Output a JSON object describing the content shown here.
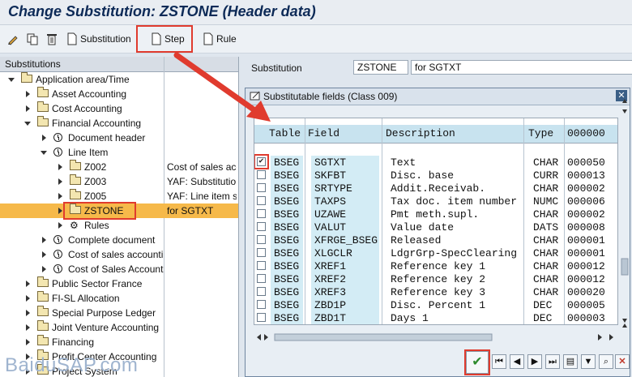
{
  "title": "Change Substitution: ZSTONE (Header data)",
  "toolbar": {
    "substitution_label": "Substitution",
    "step_label": "Step",
    "rule_label": "Rule"
  },
  "tree": {
    "header": "Substitutions",
    "rows": [
      {
        "label": "Application area/Time",
        "desc": ""
      },
      {
        "label": "Asset Accounting",
        "desc": ""
      },
      {
        "label": "Cost Accounting",
        "desc": ""
      },
      {
        "label": "Financial Accounting",
        "desc": ""
      },
      {
        "label": "Document header",
        "desc": ""
      },
      {
        "label": "Line Item",
        "desc": ""
      },
      {
        "label": "Z002",
        "desc": "Cost of sales acc"
      },
      {
        "label": "Z003",
        "desc": "YAF: Substitutio"
      },
      {
        "label": "Z005",
        "desc": "YAF: Line item s"
      },
      {
        "label": "ZSTONE",
        "desc": "for SGTXT"
      },
      {
        "label": "Rules",
        "desc": ""
      },
      {
        "label": "Complete document",
        "desc": ""
      },
      {
        "label": "Cost of sales accounti",
        "desc": ""
      },
      {
        "label": "Cost of Sales Account",
        "desc": ""
      },
      {
        "label": "Public Sector France",
        "desc": ""
      },
      {
        "label": "FI-SL Allocation",
        "desc": ""
      },
      {
        "label": "Special Purpose Ledger",
        "desc": ""
      },
      {
        "label": "Joint Venture Accounting",
        "desc": ""
      },
      {
        "label": "Financing",
        "desc": ""
      },
      {
        "label": "Profit Center Accounting",
        "desc": ""
      },
      {
        "label": "Project System",
        "desc": ""
      }
    ]
  },
  "substitution": {
    "label": "Substitution",
    "value": "ZSTONE",
    "desc": "for SGTXT"
  },
  "dialog": {
    "title": "Substitutable fields (Class 009)",
    "columns": [
      "Table",
      "Field",
      "Description",
      "Type",
      "000000"
    ],
    "rows": [
      {
        "table": "BSEG",
        "field": "SGTXT",
        "desc": "Text",
        "type": "CHAR",
        "len": "000050",
        "checked": true
      },
      {
        "table": "BSEG",
        "field": "SKFBT",
        "desc": "Disc. base",
        "type": "CURR",
        "len": "000013",
        "checked": false
      },
      {
        "table": "BSEG",
        "field": "SRTYPE",
        "desc": "Addit.Receivab.",
        "type": "CHAR",
        "len": "000002",
        "checked": false
      },
      {
        "table": "BSEG",
        "field": "TAXPS",
        "desc": "Tax doc. item number",
        "type": "NUMC",
        "len": "000006",
        "checked": false
      },
      {
        "table": "BSEG",
        "field": "UZAWE",
        "desc": "Pmt meth.supl.",
        "type": "CHAR",
        "len": "000002",
        "checked": false
      },
      {
        "table": "BSEG",
        "field": "VALUT",
        "desc": "Value date",
        "type": "DATS",
        "len": "000008",
        "checked": false
      },
      {
        "table": "BSEG",
        "field": "XFRGE_BSEG",
        "desc": "Released",
        "type": "CHAR",
        "len": "000001",
        "checked": false
      },
      {
        "table": "BSEG",
        "field": "XLGCLR",
        "desc": "LdgrGrp-SpecClearing",
        "type": "CHAR",
        "len": "000001",
        "checked": false
      },
      {
        "table": "BSEG",
        "field": "XREF1",
        "desc": "Reference key 1",
        "type": "CHAR",
        "len": "000012",
        "checked": false
      },
      {
        "table": "BSEG",
        "field": "XREF2",
        "desc": "Reference key 2",
        "type": "CHAR",
        "len": "000012",
        "checked": false
      },
      {
        "table": "BSEG",
        "field": "XREF3",
        "desc": "Reference key 3",
        "type": "CHAR",
        "len": "000020",
        "checked": false
      },
      {
        "table": "BSEG",
        "field": "ZBD1P",
        "desc": "Disc. Percent 1",
        "type": "DEC",
        "len": "000005",
        "checked": false
      },
      {
        "table": "BSEG",
        "field": "ZBD1T",
        "desc": "Days 1",
        "type": "DEC",
        "len": "000003",
        "checked": false
      }
    ]
  },
  "watermark": "BaiduSAP.com",
  "colors": {
    "highlight": "#e03b2e",
    "selected_row": "#f6b94a",
    "title_text": "#0d2a57"
  }
}
